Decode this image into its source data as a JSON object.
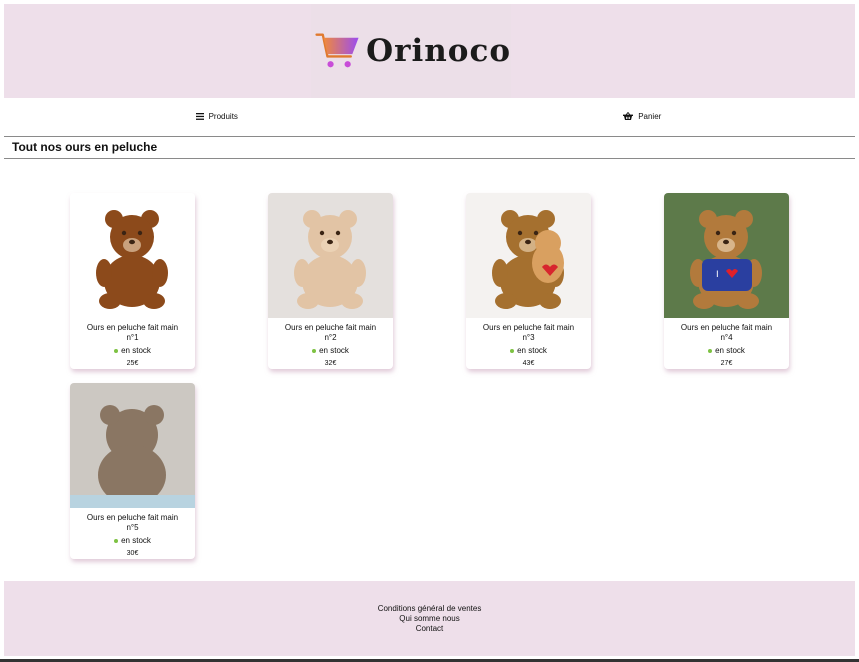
{
  "brand": {
    "name": "Orinoco"
  },
  "nav": {
    "products_label": "Produits",
    "cart_label": "Panier"
  },
  "section": {
    "title": "Tout nos ours en peluche"
  },
  "products": [
    {
      "name": "Ours en peluche fait main n°1",
      "stock": "en stock",
      "price": "25€",
      "fur_color": "#8c4a1b"
    },
    {
      "name": "Ours en peluche fait main n°2",
      "stock": "en stock",
      "price": "32€",
      "fur_color": "#e2c4a5"
    },
    {
      "name": "Ours en peluche fait main n°3",
      "stock": "en stock",
      "price": "43€",
      "fur_color": "#a5702f"
    },
    {
      "name": "Ours en peluche fait main n°4",
      "stock": "en stock",
      "price": "27€",
      "fur_color": "#b27a3c"
    },
    {
      "name": "Ours en peluche fait main n°5",
      "stock": "en stock",
      "price": "30€",
      "fur_color": "#8a7663"
    }
  ],
  "footer": {
    "links": [
      "Conditions général de ventes",
      "Qui somme nous",
      "Contact"
    ]
  },
  "colors": {
    "header_bg": "#eedfea",
    "stock_dot": "#7dc242",
    "cart_gradient_start": "#f08a3c",
    "cart_gradient_end": "#9b4cf0"
  }
}
